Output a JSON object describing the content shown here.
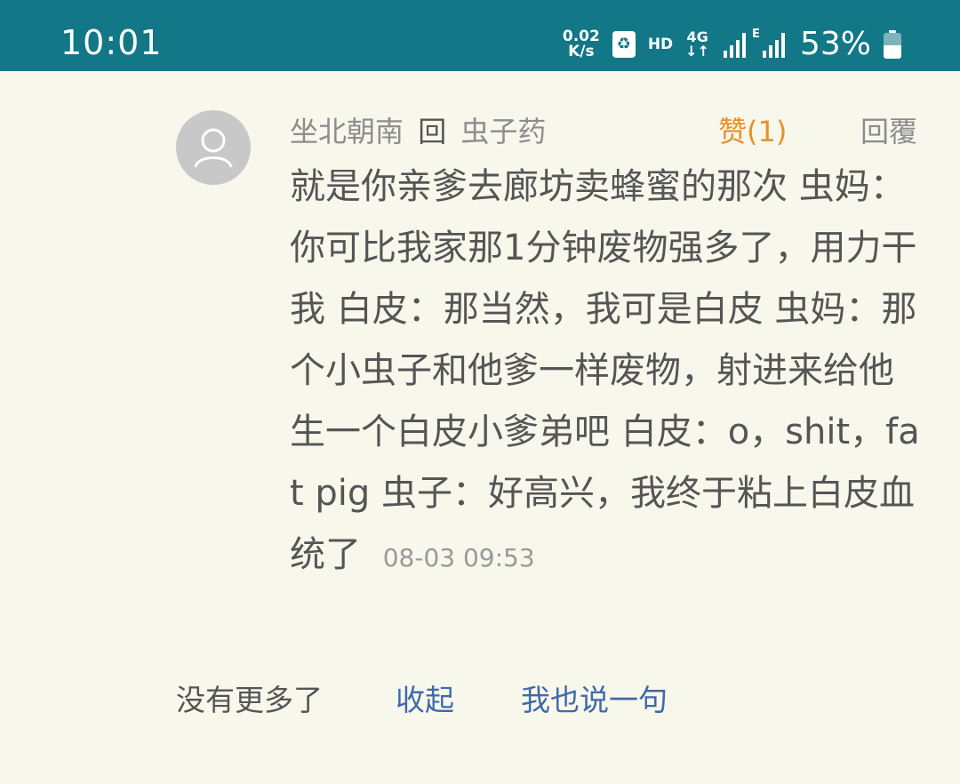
{
  "status_bar": {
    "time": "10:01",
    "net_speed_value": "0.02",
    "net_speed_unit": "K/s",
    "hd_label": "HD",
    "network_type": "4G",
    "network_arrows": "↓↑",
    "signal2_label": "E",
    "battery_percent": "53%",
    "battery_level": 0.53,
    "background_color": "#127786"
  },
  "comment": {
    "author": "坐北朝南",
    "reply_marker": "回",
    "reply_to": "虫子药",
    "like_label": "赞(1)",
    "reply_button_label": "回覆",
    "text": "就是你亲爹去廊坊卖蜂蜜的那次 虫妈：你可比我家那1分钟废物强多了，用力干我 白皮：那当然，我可是白皮 虫妈：那个小虫子和他爹一样废物，射进来给他生一个白皮小爹弟吧 白皮：o，shit，fat pig 虫子：好高兴，我终于粘上白皮血统了",
    "timestamp": "08-03 09:53"
  },
  "footer": {
    "no_more": "没有更多了",
    "collapse": "收起",
    "say_something": "我也说一句"
  },
  "colors": {
    "page_background": "#f8f7ec",
    "like_color": "#e8902a",
    "link_color": "#3f6aa8"
  }
}
